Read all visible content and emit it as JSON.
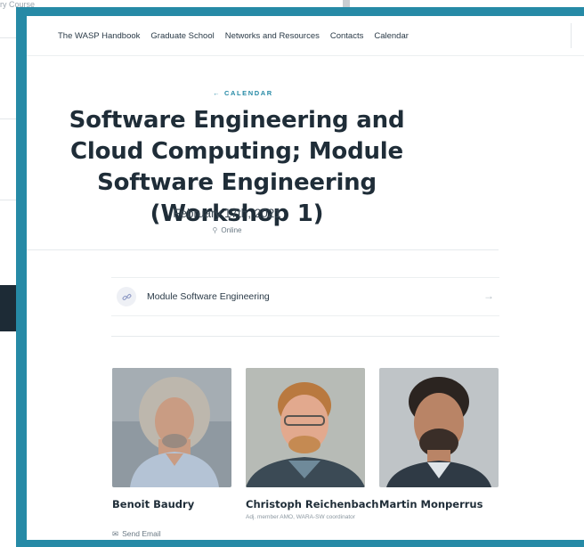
{
  "background": {
    "snippet": "ry Course"
  },
  "nav": {
    "items": [
      "The WASP Handbook",
      "Graduate School",
      "Networks and Resources",
      "Contacts",
      "Calendar"
    ]
  },
  "back_link": "← CALENDAR",
  "event": {
    "title": "Software Engineering and Cloud Computing; Module Software Engineering (Workshop 1)",
    "date": "February 17th, 2021",
    "location": "Online",
    "location_icon": "map-pin-icon"
  },
  "link_card": {
    "label": "Module Software Engineering",
    "icon": "link-icon",
    "arrow": "→"
  },
  "people": [
    {
      "name": "Benoit Baudry",
      "role": "",
      "send_email": "Send Email"
    },
    {
      "name": "Christoph Reichenbach",
      "role": "Adj. member AMO, WARA-SW coordinator"
    },
    {
      "name": "Martin Monperrus",
      "role": ""
    }
  ],
  "colors": {
    "frame": "#268aa6",
    "accent": "#268aa6",
    "title": "#1f2d38"
  }
}
